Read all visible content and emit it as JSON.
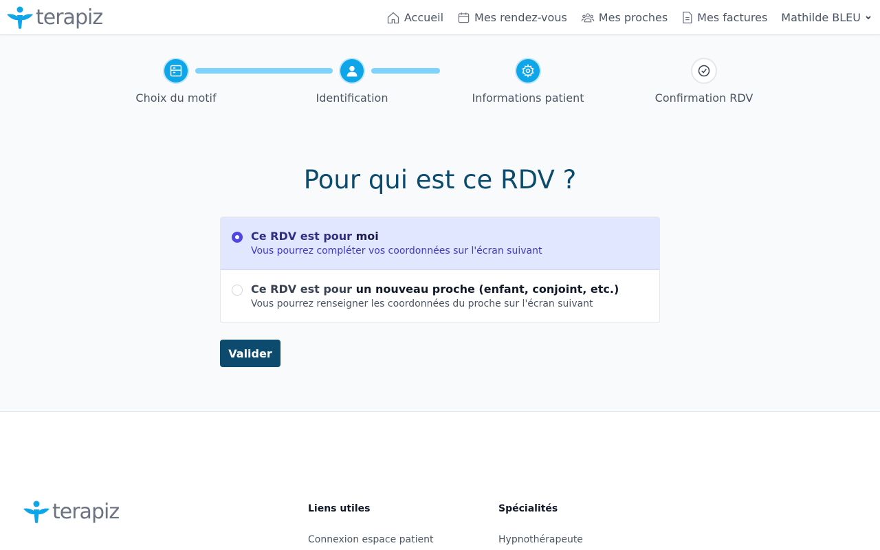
{
  "brand": {
    "name": "terapiz",
    "accent": "#0ea5e9",
    "primary": "#0c4a6e"
  },
  "nav": {
    "items": [
      {
        "icon": "home-icon",
        "label": "Accueil"
      },
      {
        "icon": "calendar-icon",
        "label": "Mes rendez-vous"
      },
      {
        "icon": "users-icon",
        "label": "Mes proches"
      },
      {
        "icon": "document-icon",
        "label": "Mes factures"
      }
    ],
    "user": "Mathilde BLEU"
  },
  "stepper": {
    "steps": [
      {
        "label": "Choix du motif",
        "status": "done",
        "icon": "server-icon"
      },
      {
        "label": "Identification",
        "status": "done",
        "icon": "user-icon"
      },
      {
        "label": "Informations patient",
        "status": "current",
        "icon": "gear-icon"
      },
      {
        "label": "Confirmation RDV",
        "status": "todo",
        "icon": "check-circle-icon"
      }
    ]
  },
  "main": {
    "title": "Pour qui est ce RDV ?",
    "options": [
      {
        "prefix": "Ce RDV est pour ",
        "strong": "moi",
        "description": "Vous pourrez compléter vos coordonnées sur l'écran suivant",
        "selected": true
      },
      {
        "prefix": "Ce RDV est pour ",
        "strong": "un nouveau proche (enfant, conjoint, etc.)",
        "description": "Vous pourrez renseigner les coordonnées du proche sur l'écran suivant",
        "selected": false
      }
    ],
    "submit_label": "Valider"
  },
  "footer": {
    "columns": [
      {
        "heading": "Liens utiles",
        "links": [
          "Connexion espace patient"
        ]
      },
      {
        "heading": "Spécialités",
        "links": [
          "Hypnothérapeute"
        ]
      }
    ]
  }
}
